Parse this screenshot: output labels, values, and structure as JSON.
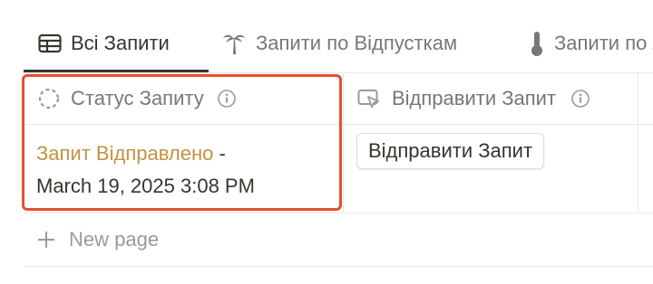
{
  "tabs": [
    {
      "label": "Всі Запити",
      "icon": "table-icon",
      "active": true
    },
    {
      "label": "Запити по Відпусткам",
      "icon": "palm-tree-icon",
      "active": false
    },
    {
      "label": "Запити по Лікарняним",
      "icon": "thermometer-icon",
      "active": false
    }
  ],
  "columns": [
    {
      "label": "Статус Запиту",
      "icon": "status-icon",
      "info_icon": "info-icon"
    },
    {
      "label": "Відправити Запит",
      "icon": "button-cursor-icon",
      "info_icon": "info-icon"
    }
  ],
  "row": {
    "status_value": "Запит Відправлено",
    "status_separator": " -",
    "status_timestamp": "March 19, 2025 3:08 PM",
    "send_button_label": "Відправити Запит"
  },
  "new_page_label": "New page",
  "colors": {
    "status_orange": "#c29343",
    "highlight_red": "#e4502f",
    "text_primary": "#37352f",
    "text_secondary": "#787774"
  }
}
